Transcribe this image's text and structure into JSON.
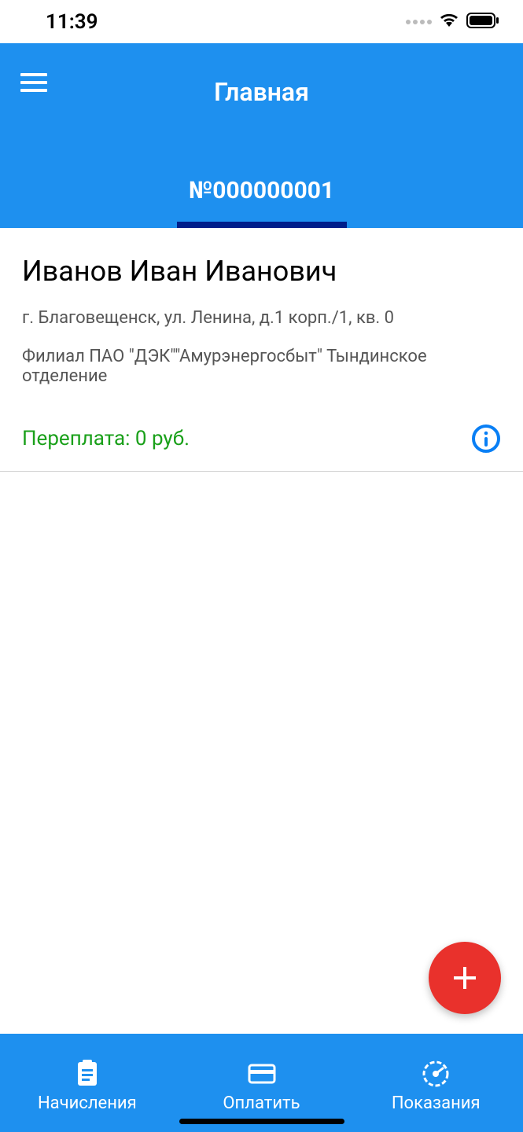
{
  "status": {
    "time": "11:39"
  },
  "header": {
    "title": "Главная",
    "account_number": "№000000001"
  },
  "customer": {
    "name": "Иванов Иван Иванович",
    "address": "г. Благовещенск, ул. Ленина, д.1 корп./1, кв. 0",
    "branch": "Филиал ПАО \"ДЭК\"\"Амурэнергосбыт\" Тындинское отделение",
    "balance_text": "Переплата: 0 руб."
  },
  "nav": {
    "items": [
      {
        "label": "Начисления"
      },
      {
        "label": "Оплатить"
      },
      {
        "label": "Показания"
      }
    ]
  }
}
